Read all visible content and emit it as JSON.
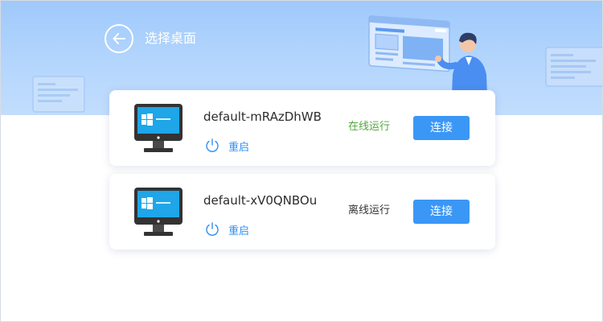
{
  "header": {
    "back_icon": "arrow-left-circle-icon",
    "title": "选择桌面"
  },
  "colors": {
    "header_bg": "#b4d6fd",
    "accent": "#3a97f6",
    "status_online": "#52a83d",
    "status_offline": "#333333"
  },
  "desktops": [
    {
      "name": "default-mRAzDhWB",
      "restart_label": "重启",
      "status": "在线运行",
      "connect_label": "连接"
    },
    {
      "name": "default-xV0QNBOu",
      "restart_label": "重启",
      "status": "离线运行",
      "connect_label": "连接"
    }
  ]
}
